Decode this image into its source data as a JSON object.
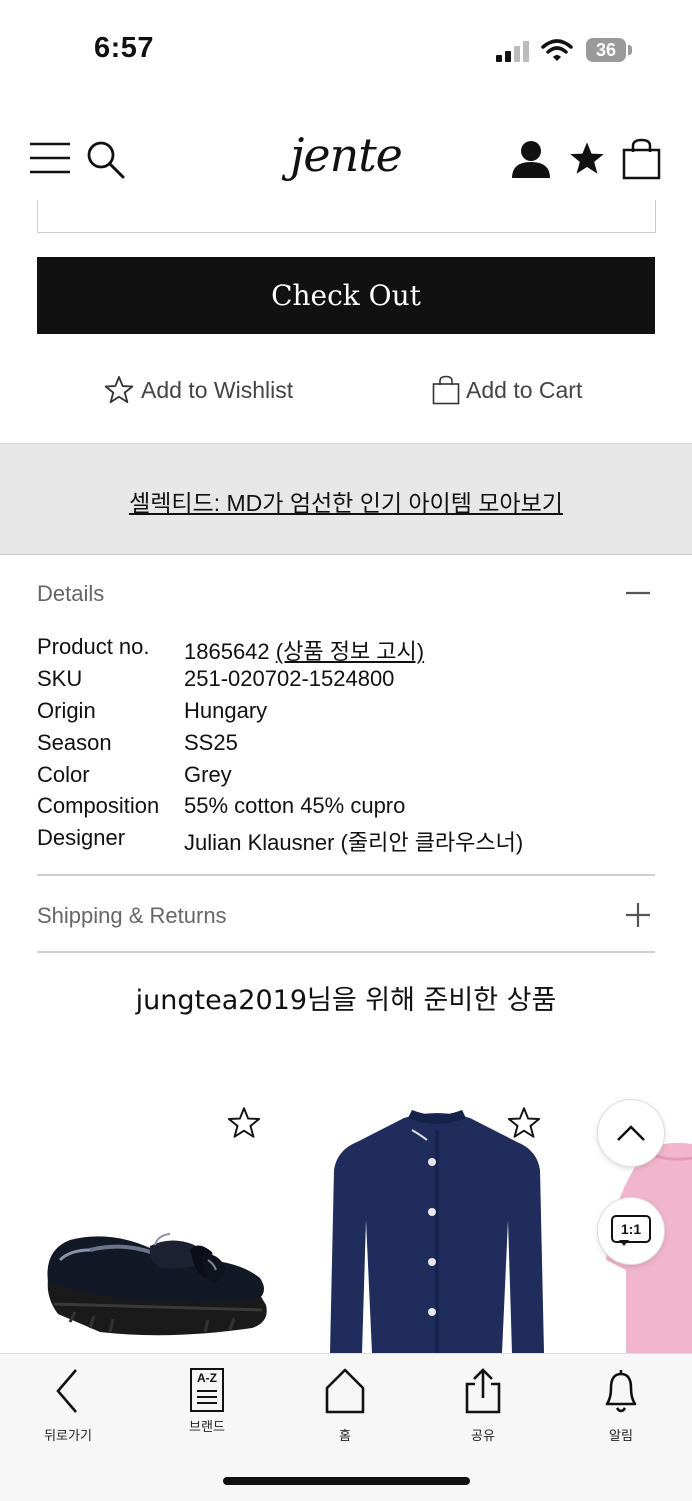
{
  "status": {
    "time": "6:57",
    "battery": "36"
  },
  "header": {
    "logo": "jente"
  },
  "actions": {
    "checkout_label": "Check Out",
    "wishlist_label": "Add to Wishlist",
    "cart_label": "Add to Cart"
  },
  "banner": {
    "text": "셀렉티드: MD가 엄선한 인기 아이템 모아보기"
  },
  "details": {
    "title": "Details",
    "rows": [
      {
        "label": "Product no.",
        "value": "1865642",
        "link": "(상품 정보 고시)"
      },
      {
        "label": "SKU",
        "value": "251-020702-1524800"
      },
      {
        "label": "Origin",
        "value": "Hungary"
      },
      {
        "label": "Season",
        "value": "SS25"
      },
      {
        "label": "Color",
        "value": "Grey"
      },
      {
        "label": "Composition",
        "value": "55% cotton 45% cupro"
      },
      {
        "label": "Designer",
        "value": "Julian Klausner (줄리안 클라우스너)"
      }
    ]
  },
  "shipping": {
    "title": "Shipping & Returns"
  },
  "recommend": {
    "title": "jungtea2019님을 위해 준비한 상품"
  },
  "floating": {
    "chat_label": "1:1"
  },
  "colors": {
    "accent": "#111111",
    "banner_bg": "#e7e7e7",
    "cardigan": "#1f2c5c",
    "pink": "#f2b6cc"
  },
  "bottom_nav": [
    {
      "label": "뒤로가기",
      "icon": "back-arrow-icon"
    },
    {
      "label": "브랜드",
      "icon": "az-brand-icon",
      "icon_text": "A-Z"
    },
    {
      "label": "홈",
      "icon": "home-icon"
    },
    {
      "label": "공유",
      "icon": "share-icon"
    },
    {
      "label": "알림",
      "icon": "bell-icon"
    }
  ]
}
